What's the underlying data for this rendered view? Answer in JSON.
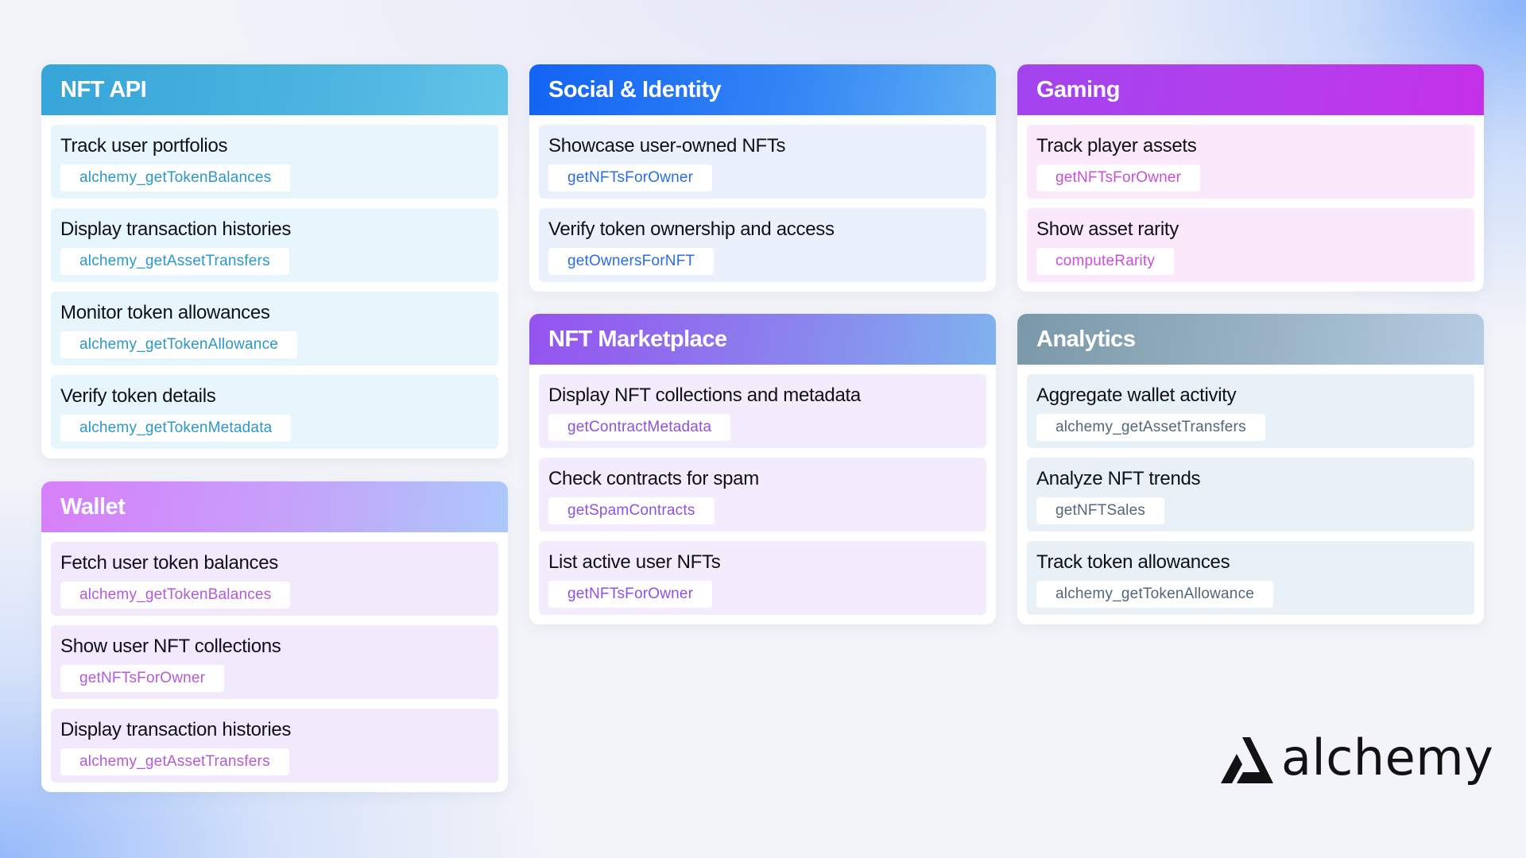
{
  "cards": {
    "nft_api": {
      "title": "NFT API",
      "items": [
        {
          "title": "Track user portfolios",
          "method": "alchemy_getTokenBalances"
        },
        {
          "title": "Display transaction histories",
          "method": "alchemy_getAssetTransfers"
        },
        {
          "title": "Monitor token allowances",
          "method": "alchemy_getTokenAllowance"
        },
        {
          "title": "Verify token details",
          "method": "alchemy_getTokenMetadata"
        }
      ]
    },
    "wallet": {
      "title": "Wallet",
      "items": [
        {
          "title": "Fetch user token balances",
          "method": "alchemy_getTokenBalances"
        },
        {
          "title": "Show user NFT collections",
          "method": "getNFTsForOwner"
        },
        {
          "title": "Display transaction histories",
          "method": "alchemy_getAssetTransfers"
        }
      ]
    },
    "social": {
      "title": "Social & Identity",
      "items": [
        {
          "title": "Showcase user-owned NFTs",
          "method": "getNFTsForOwner"
        },
        {
          "title": "Verify token ownership and access",
          "method": "getOwnersForNFT"
        }
      ]
    },
    "marketplace": {
      "title": "NFT Marketplace",
      "items": [
        {
          "title": "Display NFT collections and metadata",
          "method": "getContractMetadata"
        },
        {
          "title": "Check contracts for spam",
          "method": "getSpamContracts"
        },
        {
          "title": "List active user NFTs",
          "method": "getNFTsForOwner"
        }
      ]
    },
    "gaming": {
      "title": "Gaming",
      "items": [
        {
          "title": "Track player assets",
          "method": "getNFTsForOwner"
        },
        {
          "title": "Show asset rarity",
          "method": "computeRarity"
        }
      ]
    },
    "analytics": {
      "title": "Analytics",
      "items": [
        {
          "title": "Aggregate wallet activity",
          "method": "alchemy_getAssetTransfers"
        },
        {
          "title": "Analyze NFT trends",
          "method": "getNFTSales"
        },
        {
          "title": "Track token allowances",
          "method": "alchemy_getTokenAllowance"
        }
      ]
    }
  },
  "logo": {
    "text": "alchemy",
    "icon": "alchemy-logo-icon"
  },
  "colors": {
    "nft_api": "#36a5d8",
    "social": "#1263f3",
    "gaming": "#b43eed",
    "marketplace": "#9553ef",
    "analytics": "#7a98a8",
    "wallet": "#d77ff9"
  }
}
